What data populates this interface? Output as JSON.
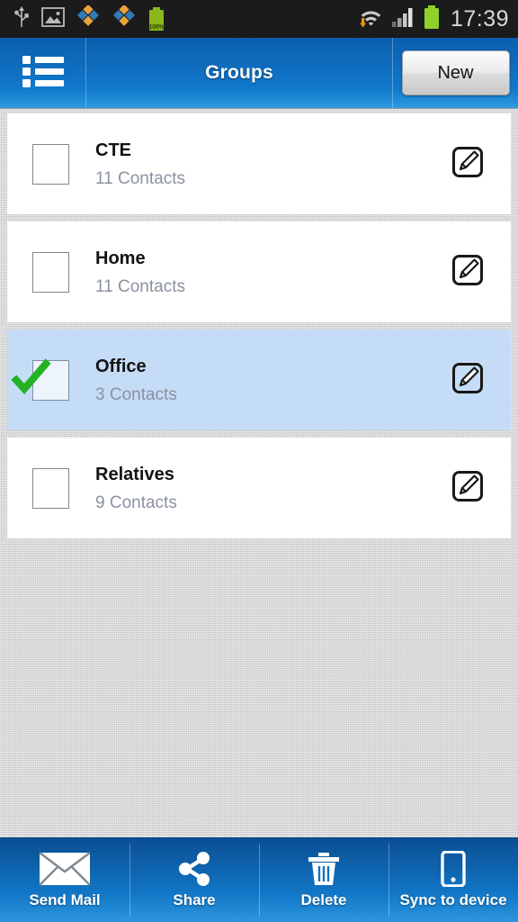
{
  "status_bar": {
    "icons_left": [
      "usb-icon",
      "screenshot-image-icon",
      "app-sync-icon",
      "app-sync-icon-2",
      "battery-charge-icon"
    ],
    "battery_percent_label": "100%",
    "icons_right": [
      "wifi-download-icon",
      "cellular-signal-icon",
      "battery-icon"
    ],
    "clock": "17:39"
  },
  "action_bar": {
    "menu_icon": "list-menu-icon",
    "title": "Groups",
    "new_label": "New"
  },
  "groups": [
    {
      "name": "CTE",
      "count_label": "11 Contacts",
      "checked": false,
      "edit_icon": "edit-pencil-icon"
    },
    {
      "name": "Home",
      "count_label": "11 Contacts",
      "checked": false,
      "edit_icon": "edit-pencil-icon"
    },
    {
      "name": "Office",
      "count_label": "3 Contacts",
      "checked": true,
      "edit_icon": "edit-pencil-icon"
    },
    {
      "name": "Relatives",
      "count_label": "9 Contacts",
      "checked": false,
      "edit_icon": "edit-pencil-icon"
    }
  ],
  "bottom_bar": {
    "items": [
      {
        "label": "Send Mail",
        "icon": "envelope-icon"
      },
      {
        "label": "Share",
        "icon": "share-nodes-icon"
      },
      {
        "label": "Delete",
        "icon": "trash-icon"
      },
      {
        "label": "Sync to device",
        "icon": "smartphone-icon"
      }
    ]
  },
  "colors": {
    "action_bar_blue": "#0f6dbe",
    "selected_row_blue": "#c5dcf7",
    "check_green": "#22b222",
    "background_gray": "#d2d2d2",
    "subtitle_gray": "#8b92a0"
  }
}
